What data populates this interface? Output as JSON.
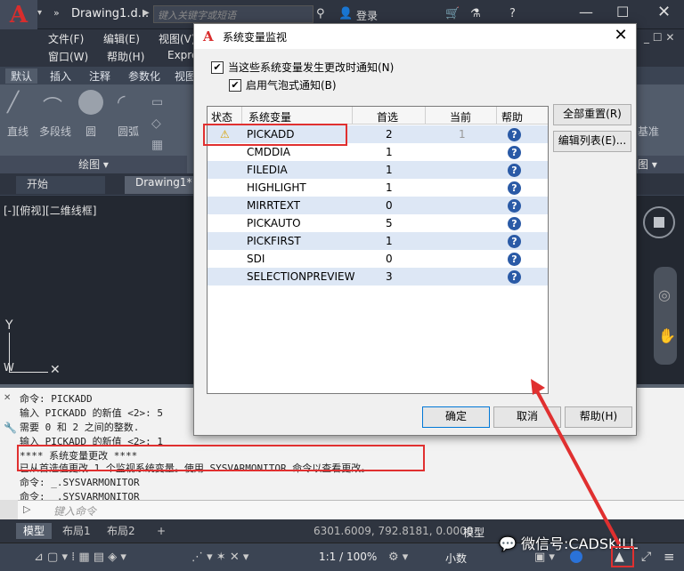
{
  "app": {
    "logo_letter": "A",
    "title": "Drawing1.d...",
    "search_placeholder": "键入关键字或短语",
    "login": "登录"
  },
  "menubar": {
    "items": [
      "文件(F)",
      "编辑(E)",
      "视图(V)",
      "窗口(W)",
      "帮助(H)",
      "Expre"
    ]
  },
  "ribbon": {
    "tabs": [
      "默认",
      "插入",
      "注释",
      "参数化",
      "视图"
    ],
    "tools": [
      "直线",
      "多段线",
      "圆",
      "圆弧"
    ],
    "panel_draw": "绘图 ▾",
    "panel_right": "图 ▾",
    "right_tool": "基准"
  },
  "filetabs": {
    "start": "开始",
    "drawing": "Drawing1*"
  },
  "viewport": {
    "label": "[-][俯视][二维线框]",
    "axis_y": "Y",
    "axis_w": "W"
  },
  "command_history": [
    "命令: PICKADD",
    "输入 PICKADD 的新值 <2>: 5",
    "需要 0 和 2 之间的整数.",
    "输入 PICKADD 的新值 <2>: 1",
    "**** 系统变量更改 ****",
    "已从首选值更改 1 个监视系统变量。使用 SYSVARMONITOR 命令以查看更改。",
    "命令: _.SYSVARMONITOR",
    "命令: _.SYSVARMONITOR"
  ],
  "command_input_placeholder": "键入命令",
  "layout_tabs": [
    "模型",
    "布局1",
    "布局2"
  ],
  "status": {
    "coords": "6301.6009, 792.8181, 0.0000",
    "model": "模型",
    "scale": "1:1 / 100%",
    "units": "小数",
    "watermark": "微信号:CADSKILL"
  },
  "dialog": {
    "title": "系统变量监视",
    "close": "✕",
    "chk_notify_label": "当这些系统变量发生更改时通知(N)",
    "chk_notify_checked": true,
    "chk_balloon_label": "启用气泡式通知(B)",
    "chk_balloon_checked": true,
    "columns": [
      "状态",
      "系统变量",
      "首选",
      "当前",
      "帮助"
    ],
    "rows": [
      {
        "status": "⚠",
        "name": "PICKADD",
        "preferred": "2",
        "current": "1",
        "help": "?"
      },
      {
        "status": "",
        "name": "CMDDIA",
        "preferred": "1",
        "current": "",
        "help": "?"
      },
      {
        "status": "",
        "name": "FILEDIA",
        "preferred": "1",
        "current": "",
        "help": "?"
      },
      {
        "status": "",
        "name": "HIGHLIGHT",
        "preferred": "1",
        "current": "",
        "help": "?"
      },
      {
        "status": "",
        "name": "MIRRTEXT",
        "preferred": "0",
        "current": "",
        "help": "?"
      },
      {
        "status": "",
        "name": "PICKAUTO",
        "preferred": "5",
        "current": "",
        "help": "?"
      },
      {
        "status": "",
        "name": "PICKFIRST",
        "preferred": "1",
        "current": "",
        "help": "?"
      },
      {
        "status": "",
        "name": "SDI",
        "preferred": "0",
        "current": "",
        "help": "?"
      },
      {
        "status": "",
        "name": "SELECTIONPREVIEW",
        "preferred": "3",
        "current": "",
        "help": "?"
      }
    ],
    "btn_reset_all": "全部重置(R)",
    "btn_edit_list": "编辑列表(E)...",
    "btn_ok": "确定",
    "btn_cancel": "取消",
    "btn_help": "帮助(H)"
  },
  "colors": {
    "accent_red": "#e03030",
    "autocad_red": "#d92d2d",
    "row_alt": "#dde7f5",
    "help_blue": "#2a5aa6"
  }
}
